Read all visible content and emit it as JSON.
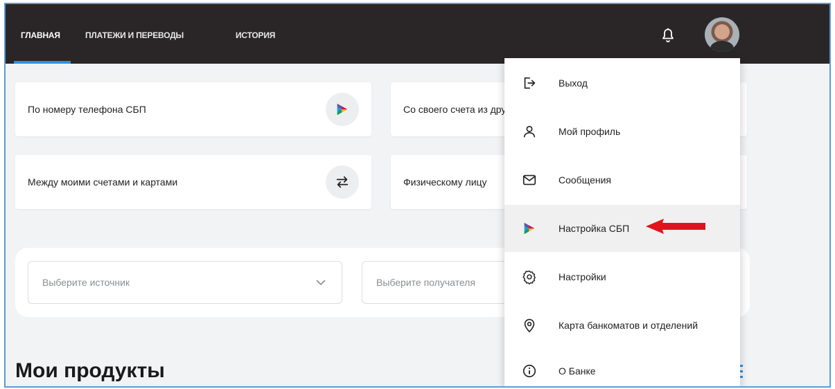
{
  "nav": {
    "tabs": [
      {
        "label": "ГЛАВНАЯ",
        "active": true
      },
      {
        "label": "ПЛАТЕЖИ И ПЕРЕВОДЫ",
        "active": false
      },
      {
        "label": "ИСТОРИЯ",
        "active": false
      }
    ]
  },
  "cards": [
    {
      "label": "По номеру телефона СБП",
      "icon": "sbp-logo-icon"
    },
    {
      "label": "Со своего счета из другого банка",
      "icon": "sbp-logo-icon"
    },
    {
      "label": "Между моими счетами и картами",
      "icon": "swap-arrows-icon"
    },
    {
      "label": "Физическому лицу",
      "icon": "person-icon"
    }
  ],
  "selectors": {
    "source_placeholder": "Выберите источник",
    "recipient_placeholder": "Выберите получателя"
  },
  "products": {
    "title": "Мои продукты"
  },
  "menu": {
    "items": [
      {
        "label": "Выход",
        "icon": "logout-icon"
      },
      {
        "label": "Мой профиль",
        "icon": "user-icon"
      },
      {
        "label": "Сообщения",
        "icon": "mail-icon"
      },
      {
        "label": "Настройка СБП",
        "icon": "sbp-logo-icon",
        "highlighted": true
      },
      {
        "label": "Настройки",
        "icon": "gear-icon"
      },
      {
        "label": "Карта банкоматов и отделений",
        "icon": "map-pin-icon"
      },
      {
        "label": "О Банке",
        "icon": "info-icon"
      }
    ]
  },
  "colors": {
    "topbar": "#2a2627",
    "accent": "#2f8fe0",
    "arrow": "#e0141e"
  }
}
